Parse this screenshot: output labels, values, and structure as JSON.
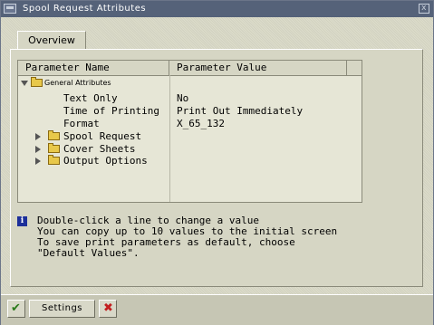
{
  "window": {
    "title": "Spool Request Attributes",
    "close_glyph": "x"
  },
  "tabs": [
    {
      "label": "Overview"
    }
  ],
  "tree": {
    "columns": {
      "name": "Parameter Name",
      "value": "Parameter Value"
    },
    "root": {
      "label": "General Attributes",
      "icon": "folder-open-icon"
    },
    "attributes": [
      {
        "name": "Text Only",
        "value": "No"
      },
      {
        "name": "Time of Printing",
        "value": "Print Out Immediately"
      },
      {
        "name": "Format",
        "value": "X_65_132"
      }
    ],
    "folders": [
      {
        "label": "Spool Request",
        "icon": "folder-icon"
      },
      {
        "label": "Cover Sheets",
        "icon": "folder-icon"
      },
      {
        "label": "Output Options",
        "icon": "folder-icon"
      }
    ]
  },
  "info": {
    "icon": "info-icon",
    "lines": [
      "Double-click a line to change a value",
      "You can copy up to 10 values to the initial screen",
      "To save print parameters as default, choose",
      "\"Default Values\"."
    ]
  },
  "footer": {
    "ok_icon": "checkmark-icon",
    "settings_label": "Settings",
    "cancel_icon": "cancel-x-icon"
  },
  "colors": {
    "titlebar": "#556279",
    "info_icon": "#1c2f9a",
    "ok": "#2a7a1a",
    "cancel": "#c21f1f",
    "folder": "#e8c84a"
  }
}
